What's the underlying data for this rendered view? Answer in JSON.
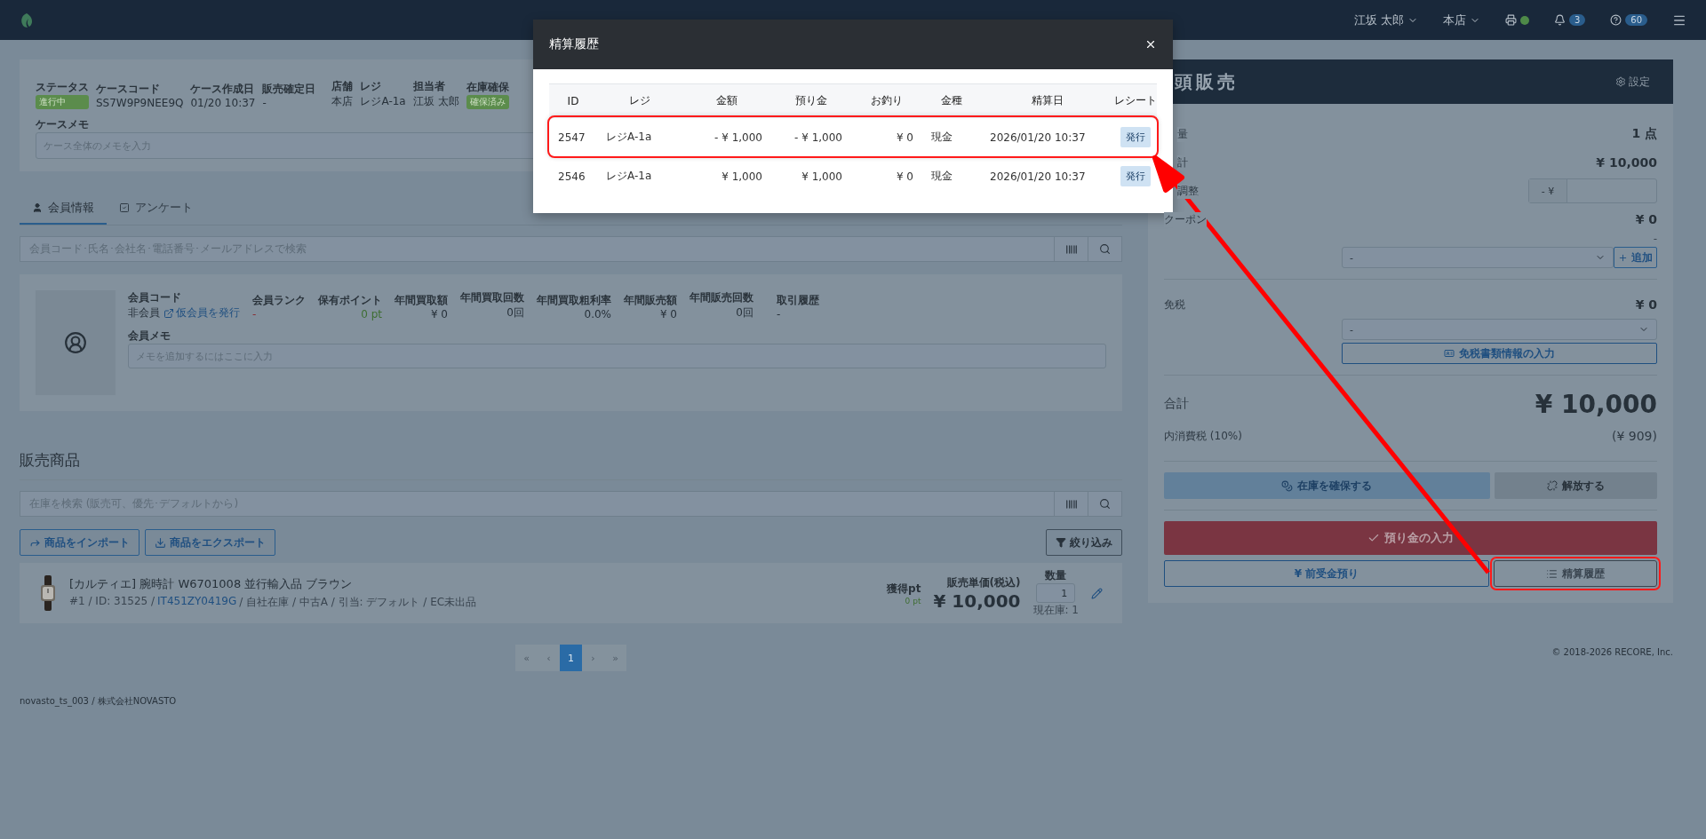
{
  "navbar": {
    "user": "江坂 太郎",
    "store": "本店",
    "notifications": "3",
    "help": "60",
    "printer_online": true
  },
  "case": {
    "fields": [
      {
        "label": "ステータス",
        "value": "進行中",
        "kind": "badge"
      },
      {
        "label": "ケースコード",
        "value": "SS7W9P9NEE9Q",
        "kind": "text"
      },
      {
        "label": "ケース作成日",
        "value": "01/20 10:37",
        "kind": "text"
      },
      {
        "label": "販売確定日",
        "value": "-",
        "kind": "text"
      },
      {
        "label": "店舗",
        "value": "本店",
        "kind": "text"
      },
      {
        "label": "レジ",
        "value": "レジA-1a",
        "kind": "text"
      },
      {
        "label": "担当者",
        "value": "江坂 太郎",
        "kind": "text"
      },
      {
        "label": "在庫確保",
        "value": "確保済み",
        "kind": "badge"
      }
    ],
    "memo_label": "ケースメモ",
    "memo_placeholder": "ケース全体のメモを入力"
  },
  "tabs": [
    {
      "label": "会員情報",
      "selected": true,
      "kind": "user"
    },
    {
      "label": "アンケート",
      "selected": false,
      "kind": "check"
    }
  ],
  "member_search": {
    "placeholder": "会員コード･氏名･会社名･電話番号･メールアドレスで検索"
  },
  "member": {
    "code_label": "会員コード",
    "code": "非会員",
    "issue_link": "仮会員を発行",
    "stats": [
      {
        "label": "会員ランク",
        "value": "-",
        "kind": "negative"
      },
      {
        "label": "保有ポイント",
        "value": "0 pt",
        "kind": "positive"
      },
      {
        "label": "年間買取額",
        "value": "¥ 0",
        "kind": "plain"
      },
      {
        "label": "年間買取回数",
        "value": "0回",
        "kind": "plain"
      },
      {
        "label": "年間買取粗利率",
        "value": "0.0%",
        "kind": "plain"
      },
      {
        "label": "年間販売額",
        "value": "¥ 0",
        "kind": "plain"
      },
      {
        "label": "年間販売回数",
        "value": "0回",
        "kind": "plain"
      },
      {
        "label": "取引履歴",
        "value": "-",
        "kind": "plain"
      }
    ],
    "memo_label": "会員メモ",
    "memo_placeholder": "メモを追加するにはここに入力"
  },
  "products": {
    "heading": "販売商品",
    "search_placeholder": "在庫を検索 (販売可、優先･デフォルトから)",
    "import": "商品をインポート",
    "export": "商品をエクスポート",
    "filter": "絞り込み",
    "items": [
      {
        "title": "[カルティエ] 腕時計 W6701008 並行輸入品 ブラウン",
        "meta_prefix": "#1 / ID: 31525 /",
        "code": "IT451ZY0419G",
        "meta_suffix": "/ 自社在庫 / 中古A / 引当: デフォルト / EC未出品",
        "points_label": "獲得pt",
        "points": "0 pt",
        "price_label": "販売単価(税込)",
        "price": "¥ 10,000",
        "qty_label": "数量",
        "qty": "1",
        "stock": "現在庫: 1"
      }
    ]
  },
  "pagination": [
    {
      "label": "«",
      "selected": false
    },
    {
      "label": "‹",
      "selected": false
    },
    {
      "label": "1",
      "selected": true
    },
    {
      "label": "›",
      "selected": false
    },
    {
      "label": "»",
      "selected": false
    }
  ],
  "footer": {
    "left": "novasto_ts_003 / 株式会社NOVASTO",
    "right": "© 2018-2026 RECORE, Inc."
  },
  "sale": {
    "title": "頭販売",
    "settings": "設定",
    "rows": [
      {
        "label": "量",
        "value": "1 点",
        "kind": "value"
      },
      {
        "label": "計",
        "value": "¥ 10,000",
        "kind": "value"
      },
      {
        "label": "調整",
        "prefix": "- ¥",
        "kind": "input"
      }
    ],
    "coupon": {
      "label": "クーポン",
      "value": "¥ 0",
      "note": "-",
      "select": "-",
      "add": "追加"
    },
    "tax_free": {
      "label": "免税",
      "value": "¥ 0",
      "select": "-",
      "docs": "免税書類情報の入力"
    },
    "total": {
      "label": "合計",
      "value": "¥ 10,000",
      "tax_label": "内消費税 (10%)",
      "tax": "(¥ 909)"
    },
    "buttons": {
      "reserve": "在庫を確保する",
      "release": "解放する",
      "deposit": "預り金の入力",
      "advance": "¥ 前受金預り",
      "history": "精算履歴",
      "history_highlighted": true
    }
  },
  "modal": {
    "title": "精算履歴",
    "columns": [
      "ID",
      "レジ",
      "金額",
      "預り金",
      "お釣り",
      "金種",
      "精算日",
      "レシート"
    ],
    "rows": [
      {
        "cells": [
          "2547",
          "レジA-1a",
          "- ¥ 1,000",
          "- ¥ 1,000",
          "¥ 0",
          "現金",
          "2026/01/20 10:37"
        ],
        "action": "発行",
        "highlighted": true
      },
      {
        "cells": [
          "2546",
          "レジA-1a",
          "¥ 1,000",
          "¥ 1,000",
          "¥ 0",
          "現金",
          "2026/01/20 10:37"
        ],
        "action": "発行",
        "highlighted": false
      }
    ]
  }
}
